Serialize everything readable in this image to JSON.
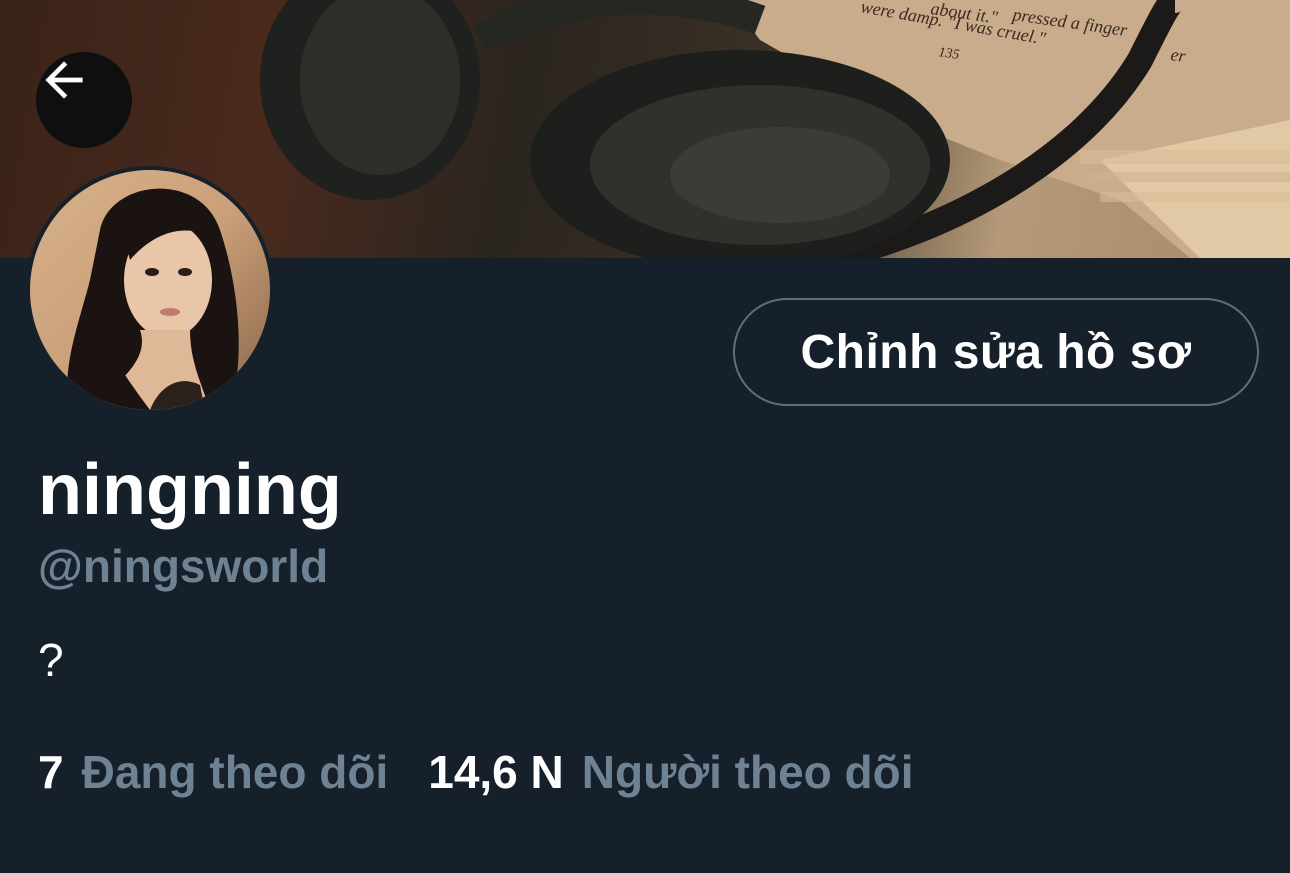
{
  "header": {
    "banner_description_icon": "headphones-book-banner",
    "back_icon": "arrow-left-icon",
    "book_text_lines": [
      "pressed a finger",
      "about it.\"",
      "were damp. \"I was cruel.\"",
      "135",
      "er"
    ]
  },
  "profile": {
    "avatar_icon": "profile-avatar",
    "edit_button_label": "Chỉnh sửa hồ sơ",
    "display_name": "ningning",
    "handle": "@ningsworld",
    "bio": "?"
  },
  "stats": {
    "following_count": "7",
    "following_label": "Đang theo dõi",
    "followers_count": "14,6 N",
    "followers_label": "Người theo dõi"
  },
  "colors": {
    "background": "#15202b",
    "secondary_text": "#6e8294",
    "primary_text": "#ffffff",
    "button_border": "#5b6f80"
  }
}
